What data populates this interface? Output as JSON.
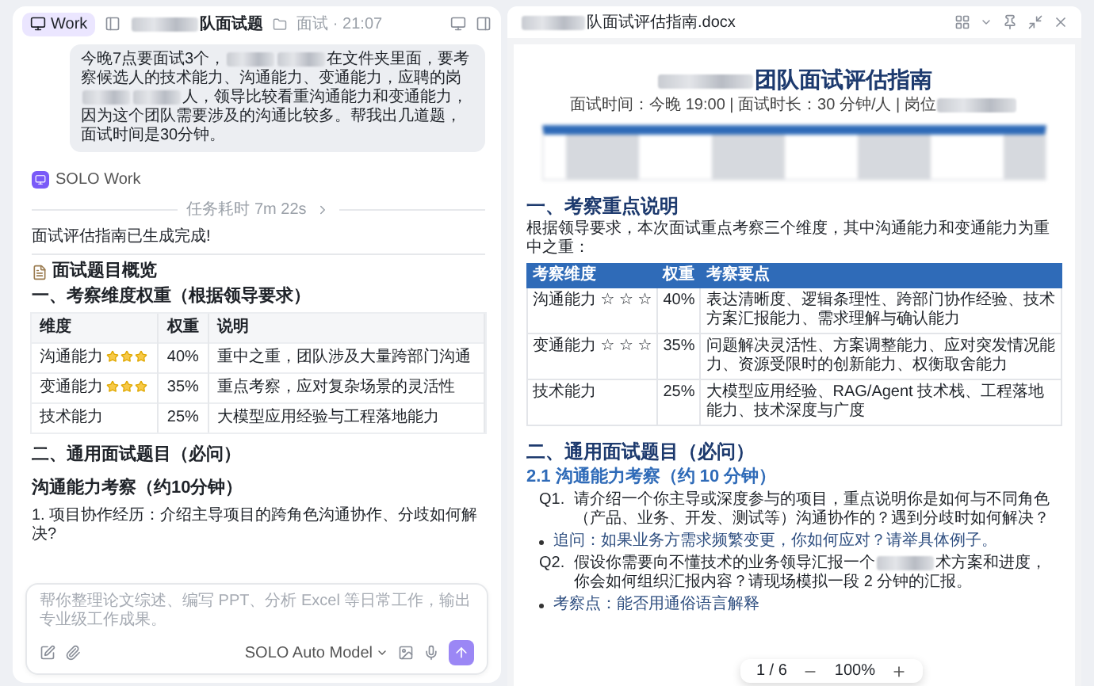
{
  "left_panel": {
    "header": {
      "mode_button": {
        "label": "Work",
        "selected": true
      },
      "title": [
        {
          "kind": "redacted"
        },
        {
          "kind": "text",
          "text": "队面试题"
        }
      ],
      "subtitle": "面试 · 21:07"
    },
    "user_message": [
      {
        "kind": "text",
        "text": "今晚7点要面试3个，"
      },
      {
        "kind": "redacted"
      },
      {
        "kind": "redacted"
      },
      {
        "kind": "text",
        "text": "在文件夹里面，要考察候选人的技术能力、沟通能力、变通能力，应聘的岗"
      },
      {
        "kind": "redacted"
      },
      {
        "kind": "redacted"
      },
      {
        "kind": "text",
        "text": "人，领导比较看重沟通能力和变通能力，因为这个团队需要涉及的沟通比较多。帮我出几道题，面试时间是30分钟。"
      }
    ],
    "agent": {
      "name": "SOLO Work",
      "duration": "任务耗时 7m 22s",
      "status": "面试评估指南已生成完成!"
    },
    "overview_title": "面试题目概览",
    "section_1": "一、考察维度权重（根据领导要求）",
    "table": {
      "columns": [
        "维度",
        "权重",
        "说明"
      ],
      "rows": [
        {
          "dimension": "沟通能力",
          "stars": 3,
          "weight": "40%",
          "note": "重中之重，团队涉及大量跨部门沟通"
        },
        {
          "dimension": "变通能力",
          "stars": 3,
          "weight": "35%",
          "note": "重点考察，应对复杂场景的灵活性"
        },
        {
          "dimension": "技术能力",
          "weight": "25%",
          "note": "大模型应用经验与工程落地能力"
        }
      ]
    },
    "section_2": "二、通用面试题目（必问）",
    "subsection": "沟通能力考察（约10分钟）",
    "question": "1. 项目协作经历：介绍主导项目的跨角色沟通协作、分歧如何解决?",
    "composer": {
      "placeholder": "帮你整理论文综述、编写 PPT、分析 Excel 等日常工作，输出专业级工作成果。",
      "model": "SOLO Auto Model"
    }
  },
  "document": {
    "file_name": [
      {
        "kind": "redacted"
      },
      {
        "kind": "text",
        "text": "队面试评估指南.docx"
      }
    ],
    "title": [
      {
        "kind": "redacted"
      },
      {
        "kind": "text",
        "text": "团队面试评估指南"
      }
    ],
    "meta": [
      {
        "kind": "text",
        "text": "面试时间：今晚 19:00 | 面试时长：30 分钟/人 | 岗位"
      },
      {
        "kind": "redacted"
      }
    ],
    "section_1": "一、考察重点说明",
    "intro": "根据领导要求，本次面试重点考察三个维度，其中沟通能力和变通能力为重中之重：",
    "table": {
      "columns": [
        "考察维度",
        "权重",
        "考察要点"
      ],
      "rows": [
        [
          "沟通能力 ☆ ☆ ☆",
          "40%",
          "表达清晰度、逻辑条理性、跨部门协作经验、技术方案汇报能力、需求理解与确认能力"
        ],
        [
          "变通能力 ☆ ☆ ☆",
          "35%",
          "问题解决灵活性、方案调整能力、应对突发情况能力、资源受限时的创新能力、权衡取舍能力"
        ],
        [
          "技术能力",
          "25%",
          "大模型应用经验、RAG/Agent 技术栈、工程落地能力、技术深度与广度"
        ]
      ]
    },
    "section_2": "二、通用面试题目（必问）",
    "subsection": "2.1 沟通能力考察（约 10 分钟）",
    "items": [
      {
        "kind": "question",
        "label": "Q1.",
        "text": [
          {
            "kind": "text",
            "text": "请介绍一个你主导或深度参与的项目，重点说明你是如何与不同角色（产品、业务、开发、测试等）沟通协作的？遇到分歧时如何解决？"
          }
        ]
      },
      {
        "kind": "note",
        "text": [
          {
            "kind": "text",
            "text": "追问：如果业务方需求频繁变更，你如何应对？请举具体例子。"
          }
        ]
      },
      {
        "kind": "question",
        "label": "Q2.",
        "text": [
          {
            "kind": "text",
            "text": "假设你需要向不懂技术的业务领导汇报一个"
          },
          {
            "kind": "redacted"
          },
          {
            "kind": "text",
            "text": "术方案和进度，你会如何组织汇报内容？请现场模拟一段 2 分钟的汇报。"
          }
        ]
      },
      {
        "kind": "note",
        "text": [
          {
            "kind": "text",
            "text": "考察点：能否用通俗语言解释"
          }
        ]
      }
    ],
    "pager": {
      "page": "1 / 6",
      "zoom": "100%"
    }
  }
}
